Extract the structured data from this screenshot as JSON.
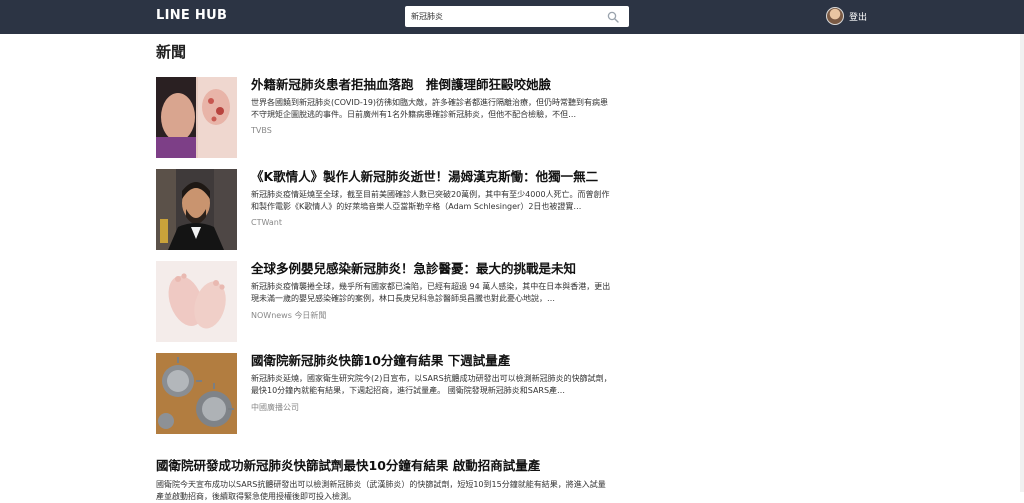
{
  "header": {
    "brand": "LINE HUB",
    "search": {
      "value": "新冠肺炎",
      "placeholder": ""
    },
    "logout_label": "登出"
  },
  "section_title": "新聞",
  "news": [
    {
      "title": "外籍新冠肺炎患者拒抽血落跑　推倒護理師狂毆咬她臉",
      "snippet": "世界各國饒到新冠肺炎(COVID-19)彷彿如臨大敵，許多確診者都進行隔離治療，但仍時常聽到有病患不守規矩企圖脫逃的事件。日前廣州有1名外籍病患確診新冠肺炎，但他不配合檢驗，不但…",
      "source": "TVBS"
    },
    {
      "title": "《K歌情人》製作人新冠肺炎逝世！湯姆漢克斯慟：他獨一無二",
      "snippet": "新冠肺炎疫情延燒至全球，截至目前美國確診人數已突破20萬例，其中有至少4000人死亡。而曾創作和製作電影《K歌情人》的好萊塢音樂人亞當斯勒辛格（Adam Schlesinger）2日也被證實…",
      "source": "CTWant"
    },
    {
      "title": "全球多例嬰兒感染新冠肺炎！急診醫憂：最大的挑戰是未知",
      "snippet": "新冠肺炎疫情襲捲全球，幾乎所有國家都已淪陷，已經有超過 94 萬人感染，其中在日本與香港，更出現未滿一歲的嬰兒感染確診的案例，林口長庚兒科急診醫師吳昌騰也對此憂心地說，…",
      "source": "NOWnews 今日新聞"
    },
    {
      "title": "國衛院新冠肺炎快篩10分鐘有結果 下週試量產",
      "snippet": "新冠肺炎延燒，國家衛生研究院今(2)日宣布，以SARS抗體成功研發出可以檢測新冠肺炎的快篩試劑，最快10分鐘內就能有結果，下週起招商，進行試量產。 國衛院發現新冠肺炎和SARS產…",
      "source": "中國廣播公司"
    },
    {
      "title": "國衛院研發成功新冠肺炎快篩試劑最快10分鐘有結果 啟動招商試量產",
      "snippet": "國衛院今天宣布成功以SARS抗體研發出可以檢測新冠肺炎（武漢肺炎）的快篩試劑，短短10到15分鐘就能有結果，將進入試量產並啟動招商，後續取得緊急使用授權後即可投入檢測。",
      "source": ""
    }
  ]
}
